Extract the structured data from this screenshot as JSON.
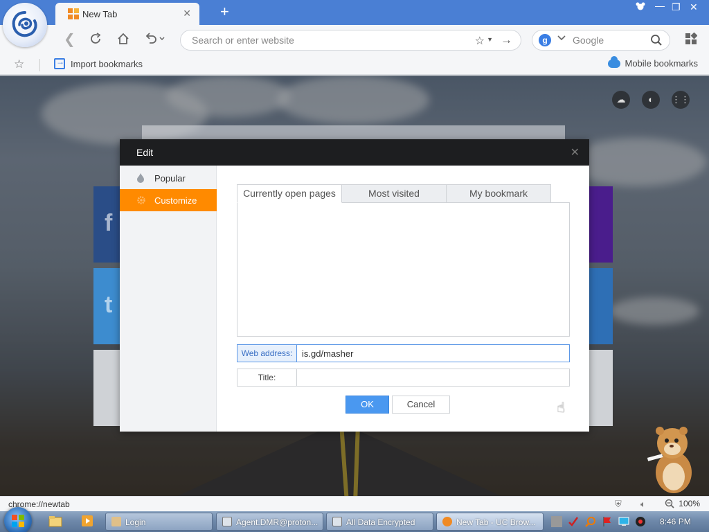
{
  "browser": {
    "tab": {
      "title": "New Tab",
      "icon": "uc-grid-icon"
    },
    "address": {
      "placeholder": "Search or enter website"
    },
    "search": {
      "engine_badge": "g",
      "placeholder": "Google"
    },
    "bookmarks_bar": {
      "import_label": "Import bookmarks",
      "mobile_label": "Mobile bookmarks"
    },
    "status": {
      "url": "chrome://newtab",
      "zoom": "100%"
    },
    "colors": {
      "titlebar": "#4a7fd4",
      "accent_orange": "#ff8a00",
      "ok_blue": "#4a98f0"
    }
  },
  "dialog": {
    "title": "Edit",
    "sidebar": [
      {
        "label": "Popular",
        "icon": "flame-icon",
        "active": false
      },
      {
        "label": "Customize",
        "icon": "gear-icon",
        "active": true
      }
    ],
    "tabs": [
      {
        "label": "Currently open pages",
        "active": true
      },
      {
        "label": "Most visited",
        "active": false
      },
      {
        "label": "My bookmark",
        "active": false
      }
    ],
    "web_address": {
      "label": "Web address:",
      "value": "is.gd/masher"
    },
    "title_field": {
      "label": "Title:",
      "value": ""
    },
    "ok_label": "OK",
    "cancel_label": "Cancel"
  },
  "taskbar": {
    "items": [
      {
        "label": "Login",
        "active": false
      },
      {
        "label": "Agent.DMR@proton...",
        "active": false
      },
      {
        "label": "All Data Encrypted",
        "active": false
      },
      {
        "label": "New Tab - UC Brow...",
        "active": true
      }
    ],
    "clock": "8:46 PM"
  }
}
